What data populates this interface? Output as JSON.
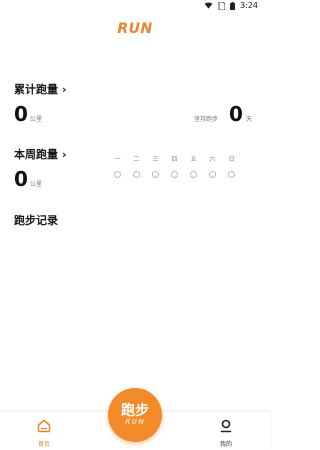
{
  "status_bar": {
    "time": "3:24"
  },
  "logo": {
    "text": "RUN"
  },
  "total": {
    "title": "累计跑量",
    "distance": "0",
    "distance_unit": "公里",
    "streak_label": "坚持跑步",
    "streak_value": "0",
    "streak_unit": "天"
  },
  "weekly": {
    "title": "本周跑量",
    "distance": "0",
    "distance_unit": "公里",
    "days": [
      "一",
      "二",
      "三",
      "四",
      "五",
      "六",
      "日"
    ]
  },
  "records": {
    "title": "跑步记录"
  },
  "tabbar": {
    "home_label": "首页",
    "mine_label": "我的",
    "run_button_label": "跑步",
    "run_button_sub": "RUN"
  },
  "colors": {
    "accent": "#f0842a"
  }
}
